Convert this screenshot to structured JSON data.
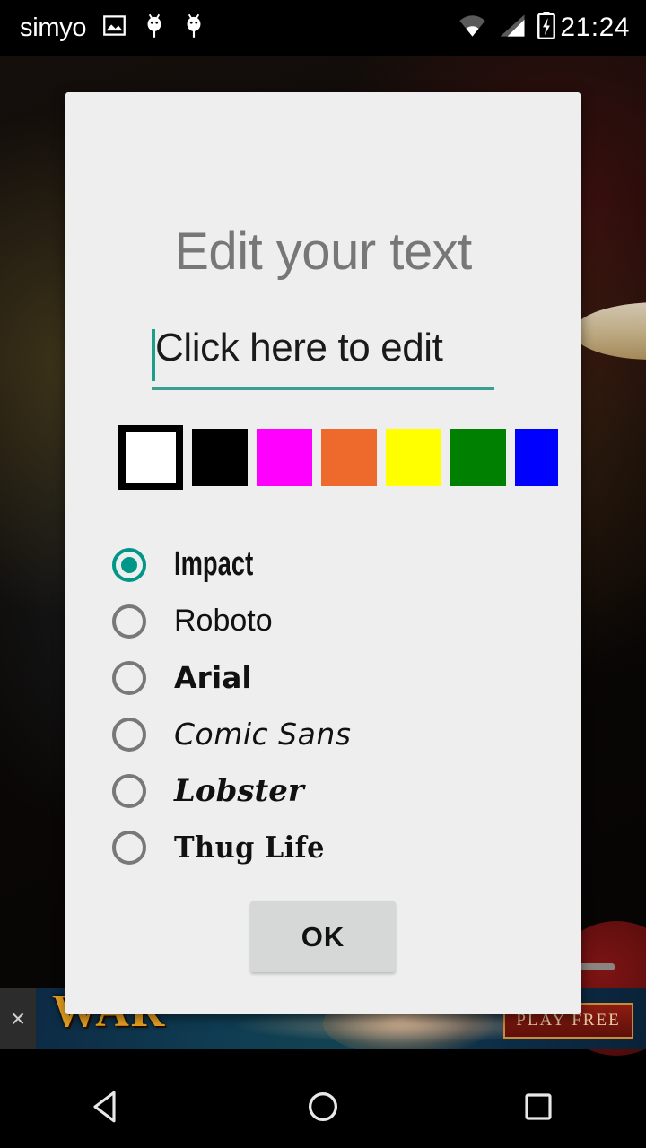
{
  "status_bar": {
    "carrier": "simyo",
    "clock": "21:24",
    "notification_icons": [
      "image-icon",
      "android-bug-icon",
      "android-bug-icon"
    ],
    "status_icons": [
      "wifi-icon",
      "signal-icon",
      "battery-charging-icon"
    ]
  },
  "dialog": {
    "title": "Edit your text",
    "text_input": {
      "value": "Click here to edit",
      "placeholder": "Click here to edit",
      "cursor_color": "#1d9e8c",
      "underline_color": "#3a9e90"
    },
    "colors": {
      "selected_index": 0,
      "swatches": [
        {
          "name": "white",
          "hex": "#ffffff"
        },
        {
          "name": "black",
          "hex": "#000000"
        },
        {
          "name": "magenta",
          "hex": "#ff00ff"
        },
        {
          "name": "orange",
          "hex": "#ed6a2c"
        },
        {
          "name": "yellow",
          "hex": "#ffff00"
        },
        {
          "name": "green",
          "hex": "#008000"
        },
        {
          "name": "blue",
          "hex": "#0000ff"
        }
      ]
    },
    "fonts": {
      "selected_index": 0,
      "accent": "#009688",
      "options": [
        {
          "label": "Impact"
        },
        {
          "label": "Roboto"
        },
        {
          "label": "Arial"
        },
        {
          "label": "Comic Sans"
        },
        {
          "label": "Lobster"
        },
        {
          "label": "Thug Life"
        }
      ]
    },
    "ok_label": "OK"
  },
  "ad": {
    "headline": "WAR",
    "cta": "PLAY FREE",
    "close_label": "×"
  },
  "nav_bar": {
    "back": "back-icon",
    "home": "home-icon",
    "recents": "recents-icon"
  }
}
